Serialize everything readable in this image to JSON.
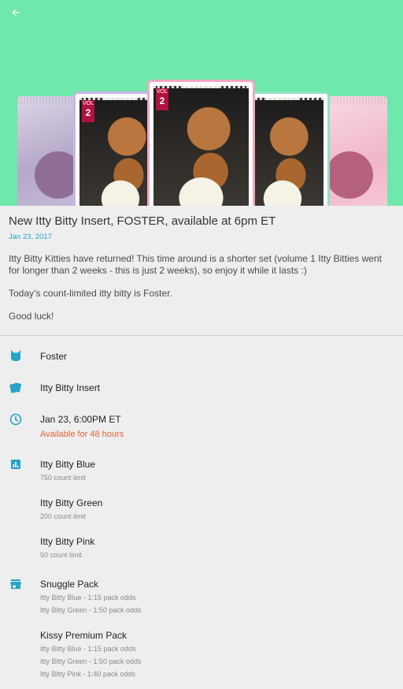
{
  "colors": {
    "hero_bg": "#6ee8ab",
    "accent": "#27a4c6",
    "warning": "#e2643a"
  },
  "hero": {
    "back_icon": "arrow-left-icon",
    "card_vol_label": "VOL",
    "card_vol_number": "2"
  },
  "post": {
    "title": "New Itty Bitty Insert, FOSTER, available at 6pm ET",
    "date": "Jan 23, 2017",
    "paragraphs": [
      "Itty Bitty Kitties have returned! This time around is a shorter set (volume 1 Itty Bitties went for longer than 2 weeks - this is just 2 weeks), so enjoy it while it lasts :)",
      "Today’s count-limited itty bitty is Foster.",
      "Good luck!"
    ]
  },
  "details": {
    "character": {
      "icon": "cat-head-icon",
      "label": "Foster"
    },
    "card_type": {
      "icon": "cards-icon",
      "label": "Itty Bitty Insert"
    },
    "time": {
      "icon": "clock-icon",
      "label": "Jan 23, 6:00PM ET",
      "availability": "Available for 48 hours"
    },
    "limits": {
      "icon": "bar-chart-icon",
      "items": [
        {
          "name": "Itty Bitty Blue",
          "limit": "750 count limit"
        },
        {
          "name": "Itty Bitty Green",
          "limit": "200 count limit"
        },
        {
          "name": "Itty Bitty Pink",
          "limit": "50 count limit"
        }
      ]
    },
    "packs": {
      "icon": "store-icon",
      "items": [
        {
          "name": "Snuggle Pack",
          "odds": [
            "Itty Bitty Blue - 1:15 pack odds",
            "Itty Bitty Green - 1:50 pack odds"
          ]
        },
        {
          "name": "Kissy Premium Pack",
          "odds": [
            "Itty Bitty Blue - 1:15 pack odds",
            "Itty Bitty Green - 1:50 pack odds",
            "Itty Bitty Pink - 1:40 pack odds"
          ]
        }
      ]
    }
  }
}
